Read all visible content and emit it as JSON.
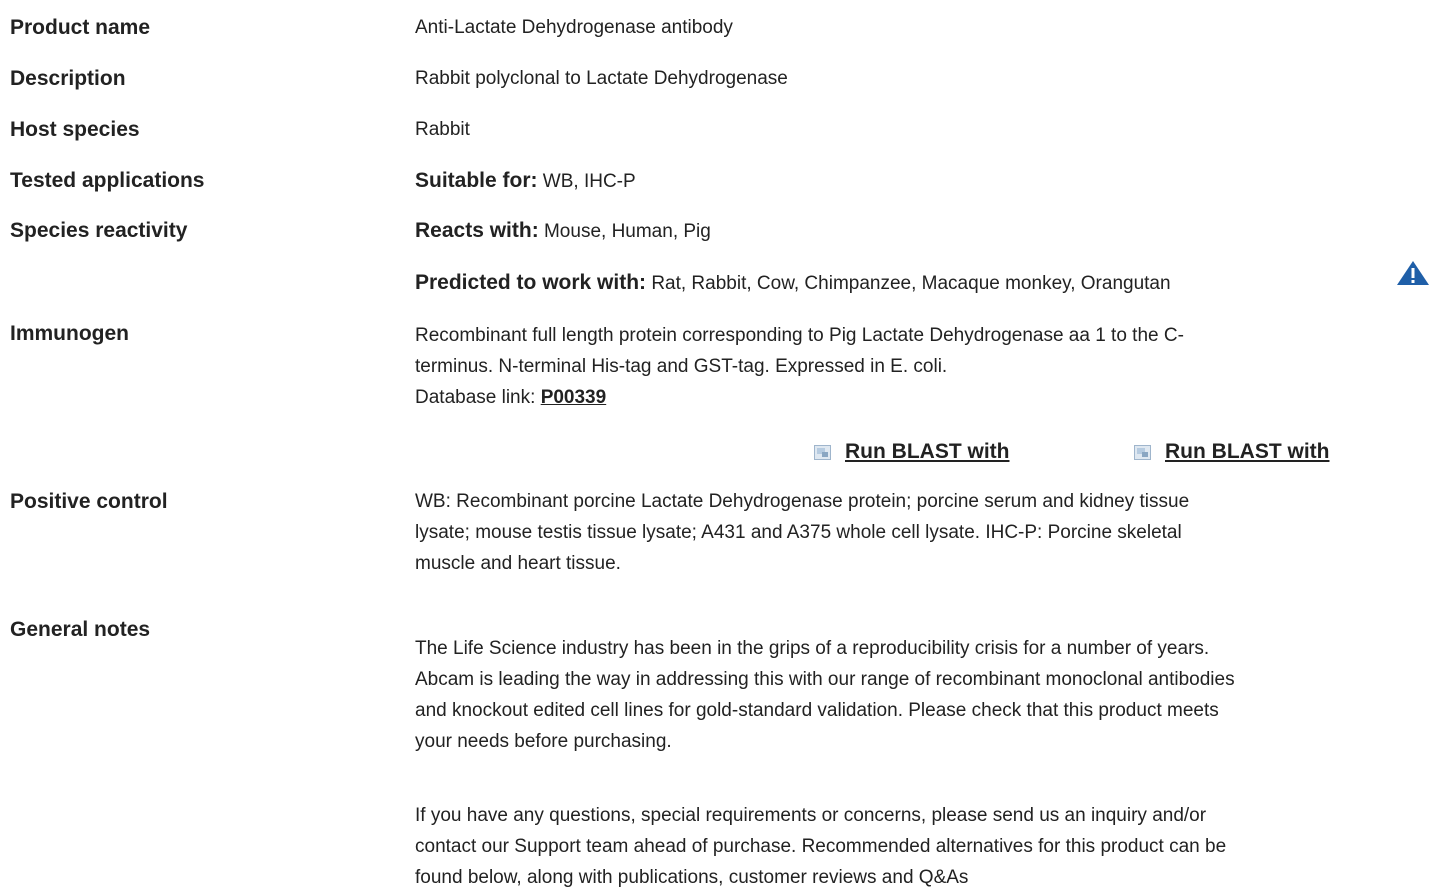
{
  "rows": {
    "product_name": {
      "label": "Product name",
      "value": "Anti-Lactate Dehydrogenase antibody"
    },
    "description": {
      "label": "Description",
      "value": "Rabbit polyclonal to Lactate Dehydrogenase"
    },
    "host_species": {
      "label": "Host species",
      "value": "Rabbit"
    },
    "tested_applications": {
      "label": "Tested applications",
      "prefix": "Suitable for:",
      "value": "WB, IHC-P"
    },
    "species_reactivity": {
      "label": "Species reactivity",
      "reacts_prefix": "Reacts with:",
      "reacts_value": "Mouse, Human, Pig",
      "predicted_prefix": "Predicted to work with:",
      "predicted_value": "Rat, Rabbit, Cow, Chimpanzee, Macaque monkey, Orangutan",
      "warning_icon": "warning-triangle-icon"
    },
    "immunogen": {
      "label": "Immunogen",
      "line1": "Recombinant full length protein corresponding to Pig Lactate Dehydrogenase aa 1 to the C-",
      "line2": "terminus. N-terminal His-tag and GST-tag. Expressed in E. coli.",
      "db_prefix": "Database link:",
      "db_link": "P00339",
      "blast_1": "Run BLAST with",
      "blast_2": "Run BLAST with",
      "blast_icon": "external-window-icon"
    },
    "positive_control": {
      "label": "Positive control",
      "line1": "WB: Recombinant porcine Lactate Dehydrogenase protein; porcine serum and kidney tissue",
      "line2": "lysate; mouse testis tissue lysate; A431 and A375 whole cell lysate. IHC-P: Porcine skeletal",
      "line3": "muscle and heart tissue."
    },
    "general_notes": {
      "label": "General notes",
      "p1_line1": "The Life Science industry has been in the grips of a reproducibility crisis for a number of years.",
      "p1_line2": "Abcam is leading the way in addressing this with our range of recombinant monoclonal antibodies",
      "p1_line3": "and knockout edited cell lines for gold-standard validation. Please check that this product meets",
      "p1_line4": "your needs before purchasing.",
      "p2_line1": "If you have any questions, special requirements or concerns, please send us an inquiry and/or",
      "p2_line2": "contact our Support team ahead of purchase. Recommended alternatives for this product can be",
      "p2_line3": "found below, along with publications, customer reviews and Q&As"
    }
  },
  "colors": {
    "text": "#222222",
    "warning_icon": "#1f5fa8"
  }
}
